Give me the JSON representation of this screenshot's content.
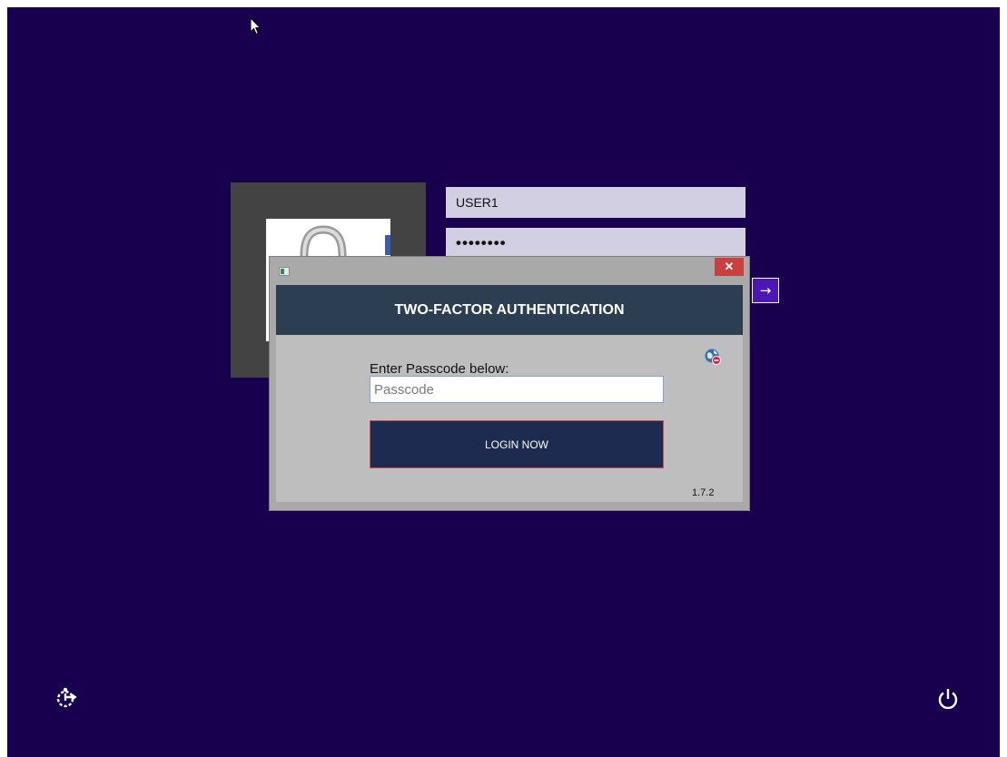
{
  "login": {
    "username": "USER1",
    "password_mask": "••••••••",
    "submit_glyph": "→"
  },
  "dialog": {
    "close_glyph": "✕",
    "header_title": "TWO-FACTOR AUTHENTICATION",
    "prompt_label": "Enter Passcode below:",
    "passcode_placeholder": "Passcode",
    "passcode_value": "",
    "login_button_label": "LOGIN NOW",
    "version": "1.7.2"
  },
  "icons": {
    "cursor": "mouse-pointer-icon",
    "tile": "padlock-image",
    "dialog_app": "app-icon",
    "globe": "globe-error-icon",
    "ease_of_access": "ease-of-access-icon",
    "power": "power-icon"
  },
  "colors": {
    "background": "#19004f",
    "dialog_header": "#2c3e52",
    "login_button": "#1c2b4f",
    "submit_arrow": "#4b17b6",
    "close_button": "#c9403f"
  }
}
